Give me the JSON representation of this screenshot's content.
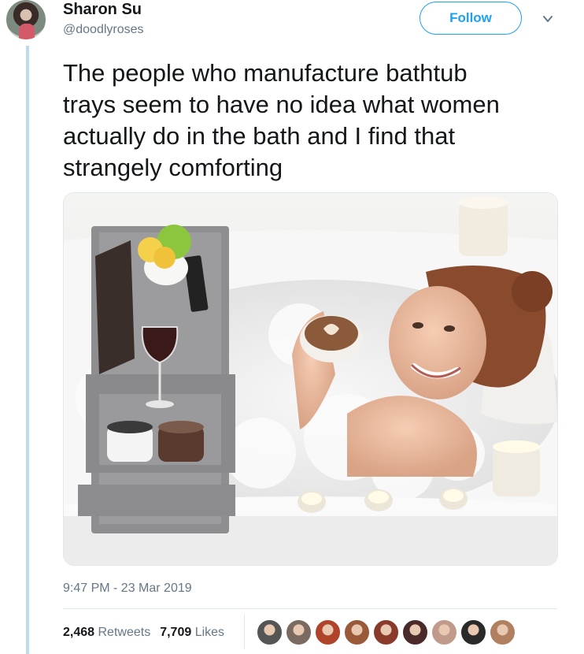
{
  "author": {
    "name": "Sharon Su",
    "handle": "@doodlyroses"
  },
  "follow_label": "Follow",
  "tweet": {
    "lines": [
      "The people who manufacture bathtub",
      "trays seem to have no idea what women",
      "actually do in the bath and I find that",
      "strangely comforting"
    ]
  },
  "timestamp": "9:47 PM - 23 Mar 2019",
  "stats": {
    "retweets_count": "2,468",
    "retweets_label": "Retweets",
    "likes_count": "7,709",
    "likes_label": "Likes"
  },
  "colors": {
    "accent": "#1da1f2",
    "muted": "#657786",
    "thread": "#b9dcf0"
  },
  "icons": {
    "caret": "chevron-down-icon"
  },
  "likers": [
    {
      "color": "#555555"
    },
    {
      "color": "#7a6a60"
    },
    {
      "color": "#b0442a"
    },
    {
      "color": "#9a5a3a"
    },
    {
      "color": "#8a3a2a"
    },
    {
      "color": "#4a2a2a"
    },
    {
      "color": "#c09a8a"
    },
    {
      "color": "#2a2a2a"
    },
    {
      "color": "#b08060"
    }
  ]
}
